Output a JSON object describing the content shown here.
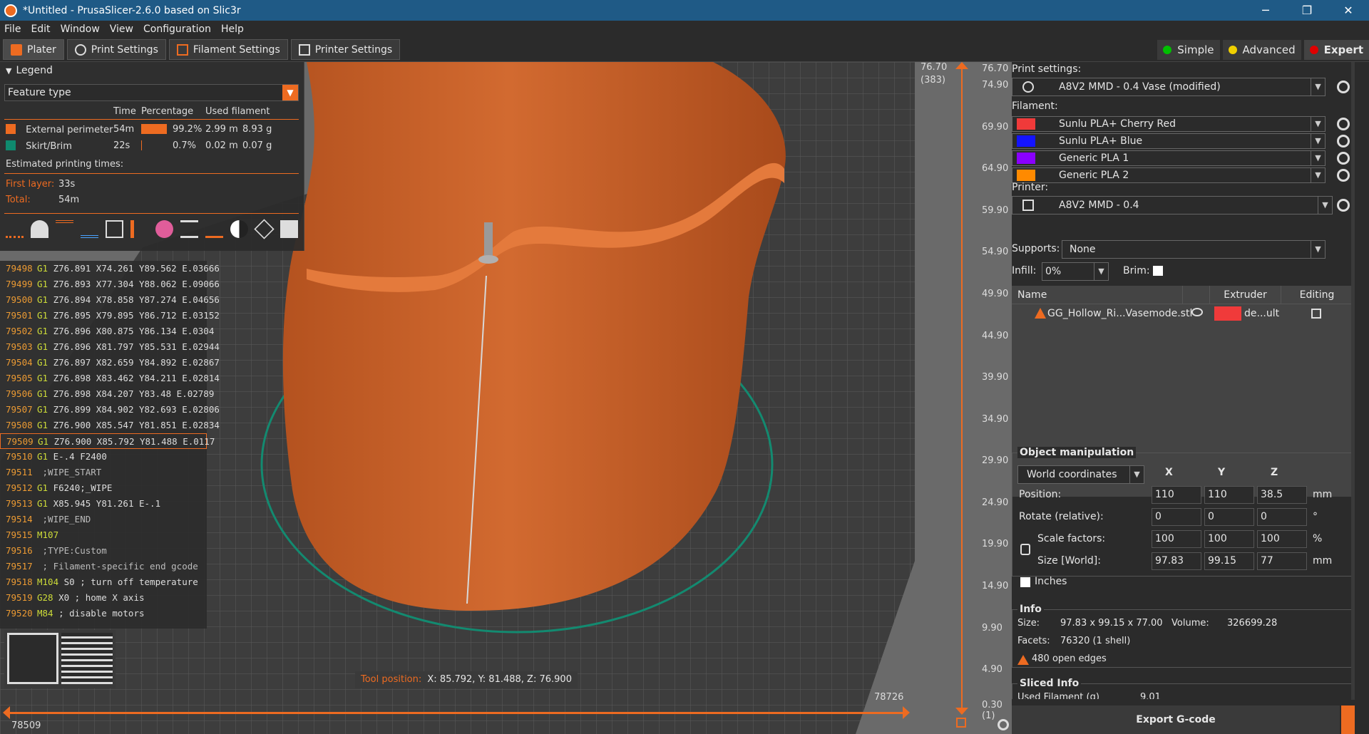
{
  "titlebar": {
    "title": "*Untitled - PrusaSlicer-2.6.0 based on Slic3r",
    "minimize": "─",
    "maximize": "❐",
    "close": "✕"
  },
  "menu": [
    "File",
    "Edit",
    "Window",
    "View",
    "Configuration",
    "Help"
  ],
  "tabs": [
    "Plater",
    "Print Settings",
    "Filament Settings",
    "Printer Settings"
  ],
  "modes": {
    "simple": "Simple",
    "advanced": "Advanced",
    "expert": "Expert"
  },
  "legend": {
    "title": "Legend",
    "feature_select": "Feature type",
    "col_time": "Time",
    "col_percentage": "Percentage",
    "col_used": "Used filament",
    "rows": [
      {
        "name": "External perimeter",
        "time": "54m",
        "pct": "99.2%",
        "len": "2.99 m",
        "weight": "8.93 g",
        "color": "#ed6b21"
      },
      {
        "name": "Skirt/Brim",
        "time": "22s",
        "pct": "0.7%",
        "len": "0.02 m",
        "weight": "0.07 g",
        "color": "#0f8a6e"
      }
    ],
    "estimated_label": "Estimated printing times:",
    "first_layer_label": "First layer:",
    "first_layer_value": "33s",
    "total_label": "Total:",
    "total_value": "54m"
  },
  "gcode": [
    {
      "n": "79498",
      "cmd": "G1",
      "rest": " Z76.891 X74.261 Y89.562 E.03666"
    },
    {
      "n": "79499",
      "cmd": "G1",
      "rest": " Z76.893 X77.304 Y88.062 E.09066"
    },
    {
      "n": "79500",
      "cmd": "G1",
      "rest": " Z76.894 X78.858 Y87.274 E.04656"
    },
    {
      "n": "79501",
      "cmd": "G1",
      "rest": " Z76.895 X79.895 Y86.712 E.03152"
    },
    {
      "n": "79502",
      "cmd": "G1",
      "rest": " Z76.896 X80.875 Y86.134 E.0304"
    },
    {
      "n": "79503",
      "cmd": "G1",
      "rest": " Z76.896 X81.797 Y85.531 E.02944"
    },
    {
      "n": "79504",
      "cmd": "G1",
      "rest": " Z76.897 X82.659 Y84.892 E.02867"
    },
    {
      "n": "79505",
      "cmd": "G1",
      "rest": " Z76.898 X83.462 Y84.211 E.02814"
    },
    {
      "n": "79506",
      "cmd": "G1",
      "rest": " Z76.898 X84.207 Y83.48 E.02789"
    },
    {
      "n": "79507",
      "cmd": "G1",
      "rest": " Z76.899 X84.902 Y82.693 E.02806"
    },
    {
      "n": "79508",
      "cmd": "G1",
      "rest": " Z76.900 X85.547 Y81.851 E.02834"
    },
    {
      "n": "79509",
      "cmd": "G1",
      "rest": " Z76.900 X85.792 Y81.488 E.0117"
    },
    {
      "n": "79510",
      "cmd": "G1",
      "rest": " E-.4 F2400"
    },
    {
      "n": "79511",
      "cmd": "",
      "rest": " ;WIPE_START"
    },
    {
      "n": "79512",
      "cmd": "G1",
      "rest": " F6240;_WIPE"
    },
    {
      "n": "79513",
      "cmd": "G1",
      "rest": " X85.945 Y81.261 E-.1"
    },
    {
      "n": "79514",
      "cmd": "",
      "rest": " ;WIPE_END"
    },
    {
      "n": "79515",
      "cmd": "M107",
      "rest": ""
    },
    {
      "n": "79516",
      "cmd": "",
      "rest": " ;TYPE:Custom"
    },
    {
      "n": "79517",
      "cmd": "",
      "rest": " ; Filament-specific end gcode"
    },
    {
      "n": "79518",
      "cmd": "M104",
      "rest": " S0 ; turn off temperature"
    },
    {
      "n": "79519",
      "cmd": "G28",
      "rest": " X0 ; home X axis"
    },
    {
      "n": "79520",
      "cmd": "M84",
      "rest": " ; disable motors"
    }
  ],
  "tool_position": {
    "label": "Tool position:",
    "value": "X: 85.792, Y: 81.488, Z: 76.900"
  },
  "hslider": {
    "left_value": "78509",
    "right_value": "78726"
  },
  "vslider": {
    "top_value": "76.70",
    "top_sub": "(383)",
    "bottom_value": "0.30",
    "bottom_sub": "(1)",
    "ticks": [
      "76.70",
      "74.90",
      "69.90",
      "64.90",
      "59.90",
      "54.90",
      "49.90",
      "44.90",
      "39.90",
      "34.90",
      "29.90",
      "24.90",
      "19.90",
      "14.90",
      "9.90",
      "4.90",
      "0.30"
    ]
  },
  "right": {
    "print_settings_label": "Print settings:",
    "print_settings_value": "A8V2 MMD - 0.4 Vase (modified)",
    "filament_label": "Filament:",
    "filaments": [
      {
        "name": "Sunlu PLA+ Cherry Red",
        "color": "#f03a3a"
      },
      {
        "name": "Sunlu PLA+ Blue",
        "color": "#1414ff"
      },
      {
        "name": "Generic PLA 1",
        "color": "#8a00ff"
      },
      {
        "name": "Generic PLA 2",
        "color": "#ff8a00"
      }
    ],
    "printer_label": "Printer:",
    "printer_value": "A8V2 MMD - 0.4",
    "supports_label": "Supports:",
    "supports_value": "None",
    "infill_label": "Infill:",
    "infill_value": "0%",
    "brim_label": "Brim:",
    "list_headers": {
      "name": "Name",
      "extruder": "Extruder",
      "editing": "Editing"
    },
    "object": {
      "name": "GG_Hollow_Ri...Vasemode.stl",
      "extruder": "de...ult",
      "extruder_color": "#f03a3a"
    },
    "om": {
      "title": "Object manipulation",
      "coords": "World coordinates",
      "x": "X",
      "y": "Y",
      "z": "Z",
      "position_label": "Position:",
      "position": [
        "110",
        "110",
        "38.5"
      ],
      "position_unit": "mm",
      "rotate_label": "Rotate (relative):",
      "rotate": [
        "0",
        "0",
        "0"
      ],
      "rotate_unit": "°",
      "scale_label": "Scale factors:",
      "scale": [
        "100",
        "100",
        "100"
      ],
      "scale_unit": "%",
      "size_label": "Size [World]:",
      "size": [
        "97.83",
        "99.15",
        "77"
      ],
      "size_unit": "mm",
      "inches_label": "Inches"
    },
    "info": {
      "title": "Info",
      "size_label": "Size:",
      "size_value": "97.83 x 99.15 x 77.00",
      "volume_label": "Volume:",
      "volume_value": "326699.28",
      "facets_label": "Facets:",
      "facets_value": "76320 (1 shell)",
      "warning": "480 open edges"
    },
    "sliced": {
      "title": "Sliced Info",
      "used_label": "Used Filament (g)",
      "used_value": "9.01"
    },
    "export_button": "Export G-code"
  },
  "colors": {
    "accent": "#ed6b21",
    "titlebar": "#1f5a86",
    "object": "#c8602a",
    "skirt": "#0f8a6e"
  }
}
